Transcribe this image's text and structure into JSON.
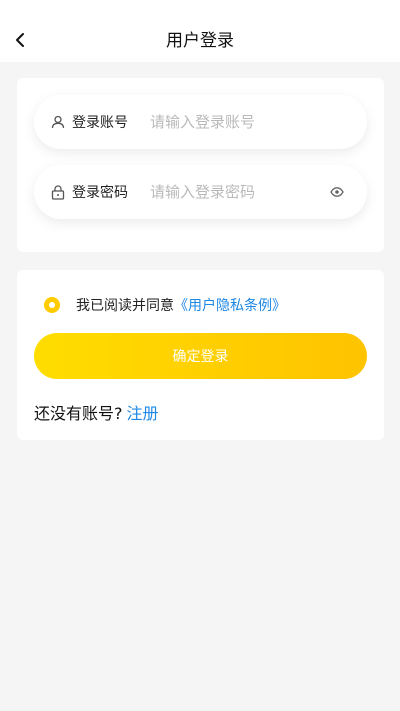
{
  "header": {
    "title": "用户登录",
    "back_icon": "chevron-left-icon"
  },
  "form": {
    "account": {
      "label": "登录账号",
      "placeholder": "请输入登录账号",
      "value": "",
      "icon": "user-icon"
    },
    "password": {
      "label": "登录密码",
      "placeholder": "请输入登录密码",
      "value": "",
      "icon": "lock-icon",
      "toggle_icon": "eye-icon"
    }
  },
  "agreement": {
    "checked": true,
    "text": "我已阅读并同意",
    "link": "《用户隐私条例》"
  },
  "actions": {
    "confirm_label": "确定登录",
    "register_prompt": "还没有账号?",
    "register_link": "注册"
  },
  "colors": {
    "accent": "#ffcc00",
    "link": "#1e88e5",
    "background": "#f5f5f5"
  }
}
